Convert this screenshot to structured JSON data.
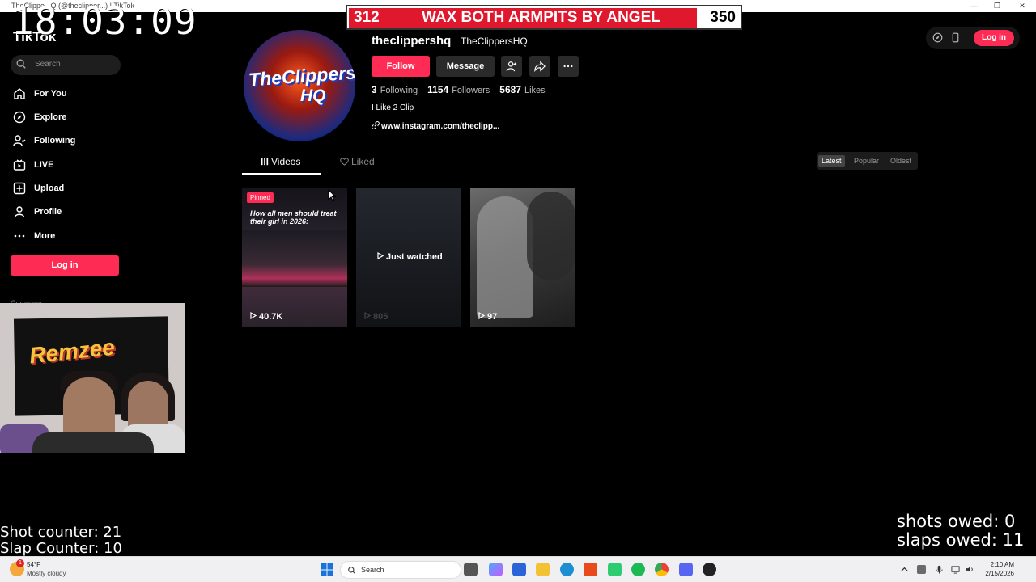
{
  "window": {
    "title": "TheClippe...Q (@theclipper...) | TikTok",
    "controls": [
      "—",
      "❐",
      "✕"
    ]
  },
  "overlay": {
    "clock": "18:03:09",
    "banner": {
      "left_number": "312",
      "text": "WAX BOTH ARMPITS BY ANGEL",
      "right_number": "350"
    },
    "shot_counter": "Shot counter: 21",
    "slap_counter": "Slap Counter: 10",
    "shots_owed": "shots owed: 0",
    "slaps_owed": "slaps owed: 11"
  },
  "sidebar": {
    "logo": "TikTok",
    "search_placeholder": "Search",
    "items": [
      {
        "label": "For You",
        "icon": "home-icon"
      },
      {
        "label": "Explore",
        "icon": "compass-icon"
      },
      {
        "label": "Following",
        "icon": "following-icon"
      },
      {
        "label": "LIVE",
        "icon": "live-icon"
      },
      {
        "label": "Upload",
        "icon": "upload-icon"
      },
      {
        "label": "Profile",
        "icon": "person-icon"
      },
      {
        "label": "More",
        "icon": "more-icon"
      }
    ],
    "login_label": "Log in",
    "company_label": "Company"
  },
  "webcam": {
    "flag_text": "Remzee"
  },
  "profile": {
    "avatar_text_1": "TheClippers",
    "avatar_text_2": "HQ",
    "username": "theclippershq",
    "nickname": "TheClippersHQ",
    "follow_label": "Follow",
    "message_label": "Message",
    "following_count": "3",
    "following_label": "Following",
    "followers_count": "1154",
    "followers_label": "Followers",
    "likes_count": "5687",
    "likes_label": "Likes",
    "bio": "I Like 2 Clip",
    "link": "www.instagram.com/theclipp..."
  },
  "tabs": {
    "videos": "Videos",
    "liked": "Liked"
  },
  "sort": {
    "latest": "Latest",
    "popular": "Popular",
    "oldest": "Oldest",
    "selected": "Latest"
  },
  "videos": [
    {
      "pinned_label": "Pinned",
      "caption": "How all men should treat their girl in 2026:",
      "views": "40.7K"
    },
    {
      "overlay_label": "Just watched",
      "views": "805"
    },
    {
      "views": "97"
    }
  ],
  "topbar": {
    "login_label": "Log in"
  },
  "taskbar": {
    "weather_temp": "54°F",
    "weather_desc": "Mostly cloudy",
    "weather_badge": "1",
    "search_label": "Search",
    "time": "2:10 AM",
    "date": "2/15/2026"
  },
  "colors": {
    "accent": "#fe2c55",
    "banner_red": "#e0182e"
  }
}
